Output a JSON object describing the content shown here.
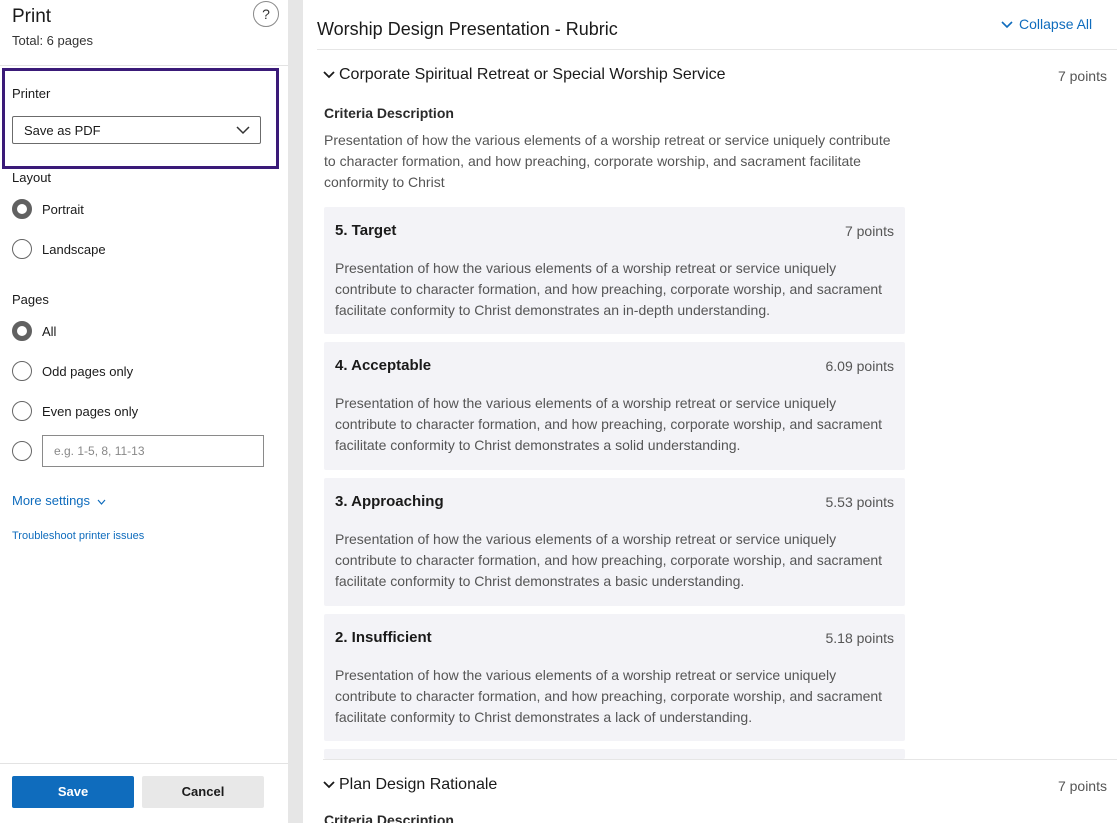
{
  "panel": {
    "title": "Print",
    "subtitle": "Total: 6 pages",
    "help": "?",
    "printer_label": "Printer",
    "printer_value": "Save as PDF",
    "layout_label": "Layout",
    "layout_options": [
      "Portrait",
      "Landscape"
    ],
    "pages_label": "Pages",
    "pages_options": [
      "All",
      "Odd pages only",
      "Even pages only"
    ],
    "range_placeholder": "e.g. 1-5, 8, 11-13",
    "more_settings": "More settings",
    "troubleshoot": "Troubleshoot printer issues",
    "save": "Save",
    "cancel": "Cancel"
  },
  "preview": {
    "doc_title": "Worship Design Presentation - Rubric",
    "collapse_all": "Collapse All",
    "criteria": [
      {
        "title": "Corporate Spiritual Retreat or Special Worship Service",
        "points": "7 points",
        "desc_label": "Criteria Description",
        "desc": "Presentation of how the various elements of a worship retreat or service uniquely contribute to character formation, and how preaching, corporate worship, and sacrament facilitate conformity to Christ",
        "levels": [
          {
            "name": "5. Target",
            "points": "7 points",
            "desc": "Presentation of how the various elements of a worship retreat or service uniquely contribute to character formation, and how preaching, corporate worship, and sacrament facilitate conformity to Christ demonstrates an in-depth understanding."
          },
          {
            "name": "4. Acceptable",
            "points": "6.09 points",
            "desc": "Presentation of how the various elements of a worship retreat or service uniquely contribute to character formation, and how preaching, corporate worship, and sacrament facilitate conformity to Christ demonstrates a solid understanding."
          },
          {
            "name": "3. Approaching",
            "points": "5.53 points",
            "desc": "Presentation of how the various elements of a worship retreat or service uniquely contribute to character formation, and how preaching, corporate worship, and sacrament facilitate conformity to Christ demonstrates a basic understanding."
          },
          {
            "name": "2. Insufficient",
            "points": "5.18 points",
            "desc": "Presentation of how the various elements of a worship retreat or service uniquely contribute to character formation, and how preaching, corporate worship, and sacrament facilitate conformity to Christ demonstrates a lack of understanding."
          }
        ]
      },
      {
        "title": "Plan Design Rationale",
        "points": "7 points",
        "desc_label": "Criteria Description"
      }
    ]
  }
}
